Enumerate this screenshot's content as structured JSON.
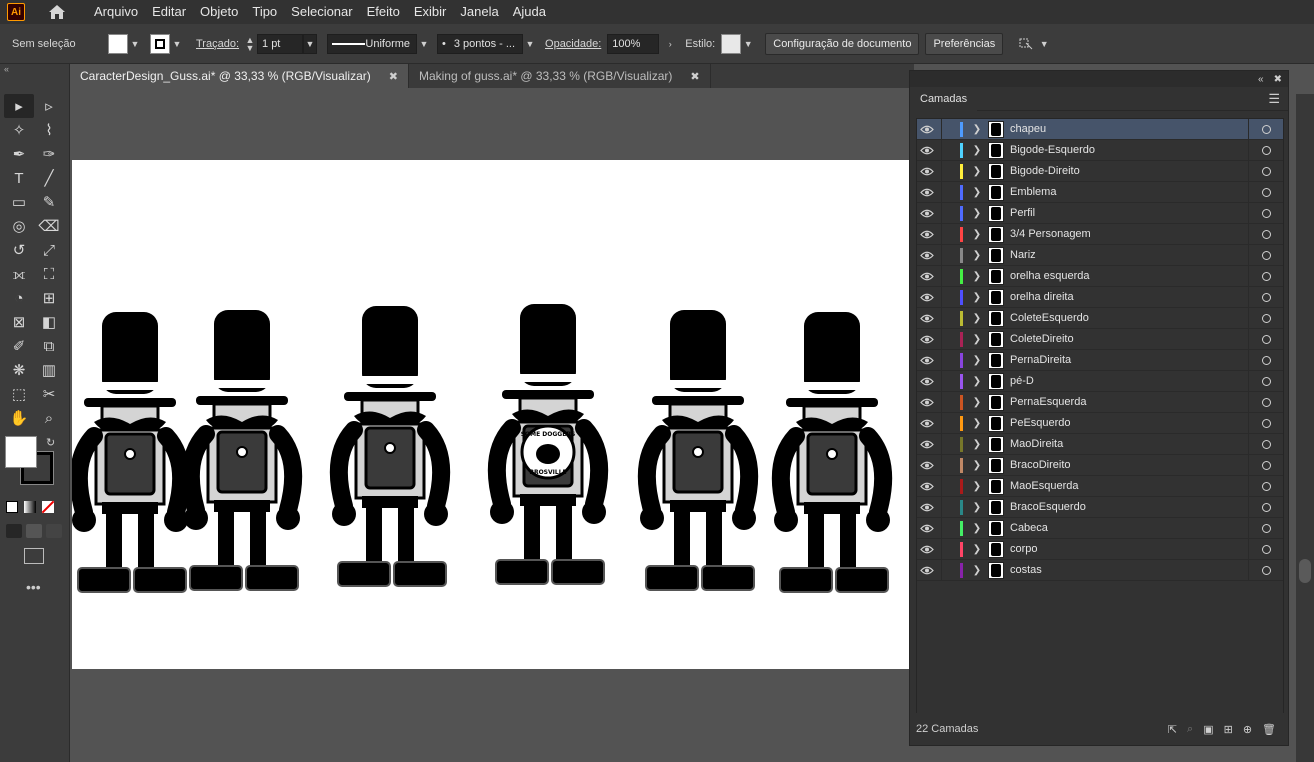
{
  "app": {
    "logo_text": "Ai"
  },
  "menu": [
    "Arquivo",
    "Editar",
    "Objeto",
    "Tipo",
    "Selecionar",
    "Efeito",
    "Exibir",
    "Janela",
    "Ajuda"
  ],
  "control_bar": {
    "selection_status": "Sem seleção",
    "stroke_label": "Traçado:",
    "stroke_weight": "1 pt",
    "stroke_profile": "Uniforme",
    "brush": "3 pontos - ...",
    "opacity_label": "Opacidade:",
    "opacity_value": "100%",
    "style_label": "Estilo:",
    "doc_setup_button": "Configuração de documento",
    "preferences_button": "Preferências"
  },
  "tabs": [
    {
      "label": "CaracterDesign_Guss.ai* @ 33,33 % (RGB/Visualizar)",
      "active": true
    },
    {
      "label": "Making of guss.ai* @ 33,33 % (RGB/Visualizar)",
      "active": false
    }
  ],
  "layers_panel": {
    "title": "Camadas",
    "layers": [
      {
        "name": "chapeu",
        "color": "#4e9bff",
        "selected": true
      },
      {
        "name": "Bigode-Esquerdo",
        "color": "#4fd2ff"
      },
      {
        "name": "Bigode-Direito",
        "color": "#ffee3b"
      },
      {
        "name": "Emblema",
        "color": "#4f6bff"
      },
      {
        "name": "Perfil",
        "color": "#4f6bff"
      },
      {
        "name": "3/4 Personagem",
        "color": "#ff4444"
      },
      {
        "name": "Nariz",
        "color": "#888888"
      },
      {
        "name": "orelha esquerda",
        "color": "#44ee44"
      },
      {
        "name": "orelha direita",
        "color": "#4f4fff"
      },
      {
        "name": "ColeteEsquerdo",
        "color": "#bbbb33"
      },
      {
        "name": "ColeteDireito",
        "color": "#aa2255"
      },
      {
        "name": "PernaDireita",
        "color": "#8844dd"
      },
      {
        "name": "pé-D",
        "color": "#9955ee"
      },
      {
        "name": "PernaEsquerda",
        "color": "#cc5522"
      },
      {
        "name": "PeEsquerdo",
        "color": "#ff9911"
      },
      {
        "name": "MaoDireita",
        "color": "#77772a"
      },
      {
        "name": "BracoDireito",
        "color": "#c08866"
      },
      {
        "name": "MaoEsquerda",
        "color": "#aa1a1a"
      },
      {
        "name": "BracoEsquerdo",
        "color": "#2a8888"
      },
      {
        "name": "Cabeca",
        "color": "#44ee66"
      },
      {
        "name": "corpo",
        "color": "#ff4466"
      },
      {
        "name": "costas",
        "color": "#8822aa"
      }
    ],
    "count_label": "22 Camadas"
  },
  "emblem_text_top": "SOME DOGGERS",
  "emblem_text_bottom": "BROSVILLE"
}
